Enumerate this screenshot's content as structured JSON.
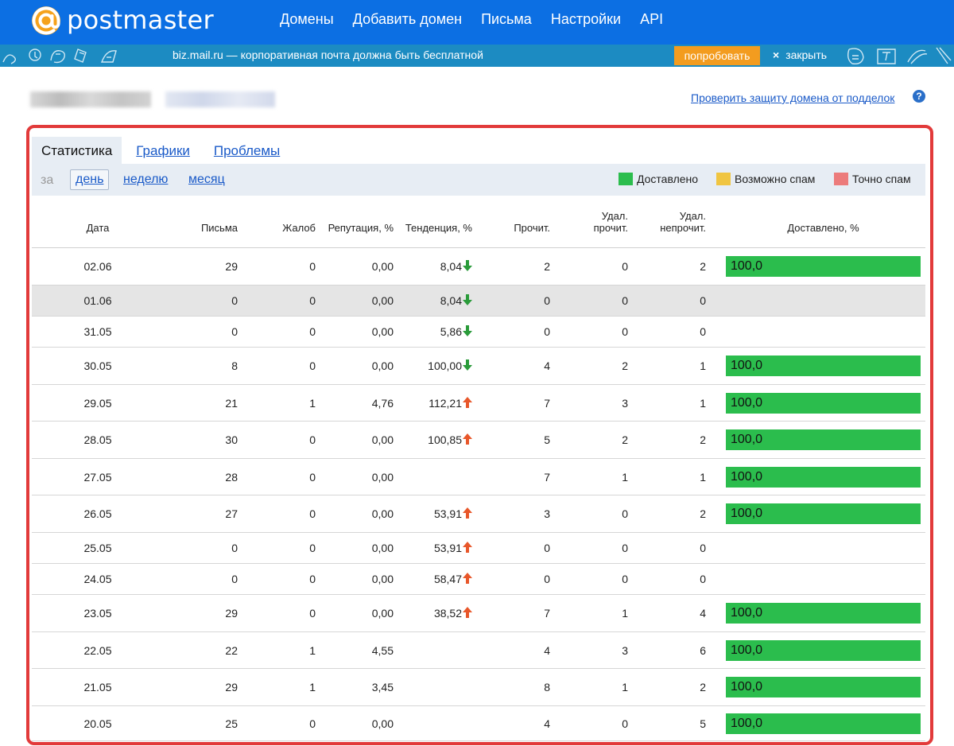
{
  "app": {
    "logo_text": "postmaster"
  },
  "nav": [
    "Домены",
    "Добавить домен",
    "Письма",
    "Настройки",
    "API"
  ],
  "promo": {
    "text": "biz.mail.ru — корпоративная почта должна быть бесплатной",
    "button": "попробовать",
    "close_symbol": "×",
    "close": "закрыть"
  },
  "domain": {
    "check_link": "Проверить защиту домена от подделок",
    "help_symbol": "?"
  },
  "tabs": [
    "Статистика",
    "Графики",
    "Проблемы"
  ],
  "period": {
    "label": "за",
    "day": "день",
    "week": "неделю",
    "month": "месяц"
  },
  "legend": [
    {
      "label": "Доставлено",
      "color": "#2bbd4d"
    },
    {
      "label": "Возможно спам",
      "color": "#f0c541"
    },
    {
      "label": "Точно спам",
      "color": "#ec7b7b"
    }
  ],
  "colors": {
    "trend_down": "#2a9b3a",
    "trend_up": "#e8572a"
  },
  "table": {
    "headers": {
      "date": "Дата",
      "mails": "Письма",
      "complaints": "Жалоб",
      "reputation": "Репутация, %",
      "trend": "Тенденция, %",
      "read": "Прочит.",
      "del_read_1": "Удал.",
      "del_read_2": "прочит.",
      "del_unread_1": "Удал.",
      "del_unread_2": "непрочит.",
      "delivered": "Доставлено, %"
    },
    "rows": [
      {
        "date": "02.06",
        "mails": "29",
        "complaints": "0",
        "reputation": "0,00",
        "trend": "8,04",
        "trend_dir": "down",
        "read": "2",
        "del_read": "0",
        "del_unread": "2",
        "delivered": "100,0"
      },
      {
        "date": "01.06",
        "mails": "0",
        "complaints": "0",
        "reputation": "0,00",
        "trend": "8,04",
        "trend_dir": "down",
        "read": "0",
        "del_read": "0",
        "del_unread": "0",
        "delivered": ""
      },
      {
        "date": "31.05",
        "mails": "0",
        "complaints": "0",
        "reputation": "0,00",
        "trend": "5,86",
        "trend_dir": "down",
        "read": "0",
        "del_read": "0",
        "del_unread": "0",
        "delivered": ""
      },
      {
        "date": "30.05",
        "mails": "8",
        "complaints": "0",
        "reputation": "0,00",
        "trend": "100,00",
        "trend_dir": "down",
        "read": "4",
        "del_read": "2",
        "del_unread": "1",
        "delivered": "100,0"
      },
      {
        "date": "29.05",
        "mails": "21",
        "complaints": "1",
        "reputation": "4,76",
        "trend": "112,21",
        "trend_dir": "up",
        "read": "7",
        "del_read": "3",
        "del_unread": "1",
        "delivered": "100,0"
      },
      {
        "date": "28.05",
        "mails": "30",
        "complaints": "0",
        "reputation": "0,00",
        "trend": "100,85",
        "trend_dir": "up",
        "read": "5",
        "del_read": "2",
        "del_unread": "2",
        "delivered": "100,0"
      },
      {
        "date": "27.05",
        "mails": "28",
        "complaints": "0",
        "reputation": "0,00",
        "trend": "",
        "trend_dir": "",
        "read": "7",
        "del_read": "1",
        "del_unread": "1",
        "delivered": "100,0"
      },
      {
        "date": "26.05",
        "mails": "27",
        "complaints": "0",
        "reputation": "0,00",
        "trend": "53,91",
        "trend_dir": "up",
        "read": "3",
        "del_read": "0",
        "del_unread": "2",
        "delivered": "100,0"
      },
      {
        "date": "25.05",
        "mails": "0",
        "complaints": "0",
        "reputation": "0,00",
        "trend": "53,91",
        "trend_dir": "up",
        "read": "0",
        "del_read": "0",
        "del_unread": "0",
        "delivered": ""
      },
      {
        "date": "24.05",
        "mails": "0",
        "complaints": "0",
        "reputation": "0,00",
        "trend": "58,47",
        "trend_dir": "up",
        "read": "0",
        "del_read": "0",
        "del_unread": "0",
        "delivered": ""
      },
      {
        "date": "23.05",
        "mails": "29",
        "complaints": "0",
        "reputation": "0,00",
        "trend": "38,52",
        "trend_dir": "up",
        "read": "7",
        "del_read": "1",
        "del_unread": "4",
        "delivered": "100,0"
      },
      {
        "date": "22.05",
        "mails": "22",
        "complaints": "1",
        "reputation": "4,55",
        "trend": "",
        "trend_dir": "",
        "read": "4",
        "del_read": "3",
        "del_unread": "6",
        "delivered": "100,0"
      },
      {
        "date": "21.05",
        "mails": "29",
        "complaints": "1",
        "reputation": "3,45",
        "trend": "",
        "trend_dir": "",
        "read": "8",
        "del_read": "1",
        "del_unread": "2",
        "delivered": "100,0"
      },
      {
        "date": "20.05",
        "mails": "25",
        "complaints": "0",
        "reputation": "0,00",
        "trend": "",
        "trend_dir": "",
        "read": "4",
        "del_read": "0",
        "del_unread": "5",
        "delivered": "100,0"
      }
    ]
  }
}
